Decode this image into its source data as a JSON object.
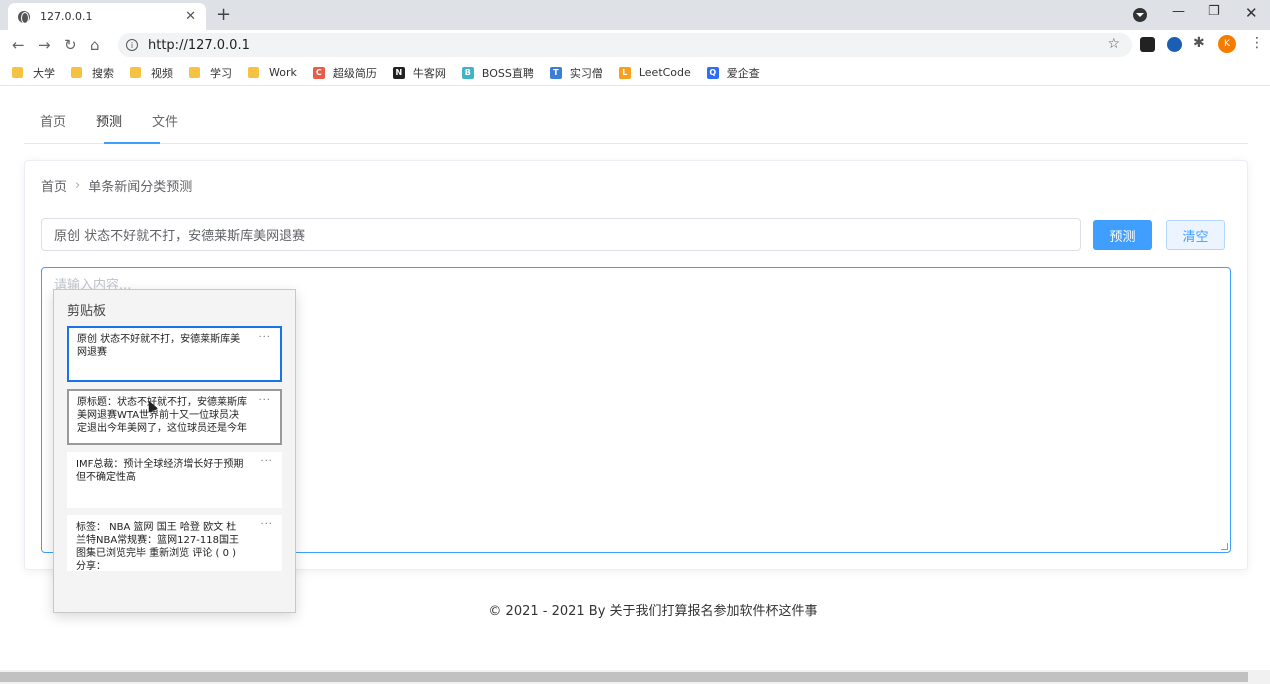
{
  "browser": {
    "tab_title": "127.0.0.1",
    "url": "http://127.0.0.1",
    "profile_initial": "K",
    "bookmarks": [
      {
        "label": "大学",
        "type": "folder"
      },
      {
        "label": "搜索",
        "type": "folder"
      },
      {
        "label": "视频",
        "type": "folder"
      },
      {
        "label": "学习",
        "type": "folder"
      },
      {
        "label": "Work",
        "type": "folder"
      },
      {
        "label": "超级简历",
        "type": "site",
        "color": "#e85d4a",
        "glyph": "C"
      },
      {
        "label": "牛客网",
        "type": "site",
        "color": "#222222",
        "glyph": "N"
      },
      {
        "label": "BOSS直聘",
        "type": "site",
        "color": "#3fb4c8",
        "glyph": "B"
      },
      {
        "label": "实习僧",
        "type": "site",
        "color": "#3b7dd8",
        "glyph": "T"
      },
      {
        "label": "LeetCode",
        "type": "site",
        "color": "#f89f1b",
        "glyph": "L"
      },
      {
        "label": "爱企查",
        "type": "site",
        "color": "#2f6df6",
        "glyph": "Q"
      }
    ]
  },
  "page": {
    "tabs": [
      "首页",
      "预测",
      "文件"
    ],
    "active_tab": "预测",
    "breadcrumb": [
      "首页",
      "单条新闻分类预测"
    ],
    "query_value": "原创 状态不好就不打，安德莱斯库美网退赛",
    "predict_label": "预测",
    "clear_label": "清空",
    "textarea_placeholder": "请输入内容...",
    "footer": "© 2021 - 2021 By 关于我们打算报名参加软件杯这件事"
  },
  "clipboard": {
    "title": "剪贴板",
    "items": [
      {
        "text": "原创 状态不好就不打，安德莱斯库美网退赛",
        "state": "selected"
      },
      {
        "text": "原标题：状态不好就不打，安德莱斯库美网退赛WTA世界前十又一位球员决定退出今年美网了，这位球员还是今年",
        "state": "hover"
      },
      {
        "text": "IMF总裁：预计全球经济增长好于预期但不确定性高",
        "state": "normal"
      },
      {
        "text": "标签： NBA 篮网 国王 哈登 欧文 杜兰特NBA常规赛：篮网127-118国王 图集已浏览完毕 重新浏览 评论 ( 0 ) 分享：",
        "state": "normal"
      }
    ]
  },
  "colors": {
    "accent": "#409eff"
  }
}
